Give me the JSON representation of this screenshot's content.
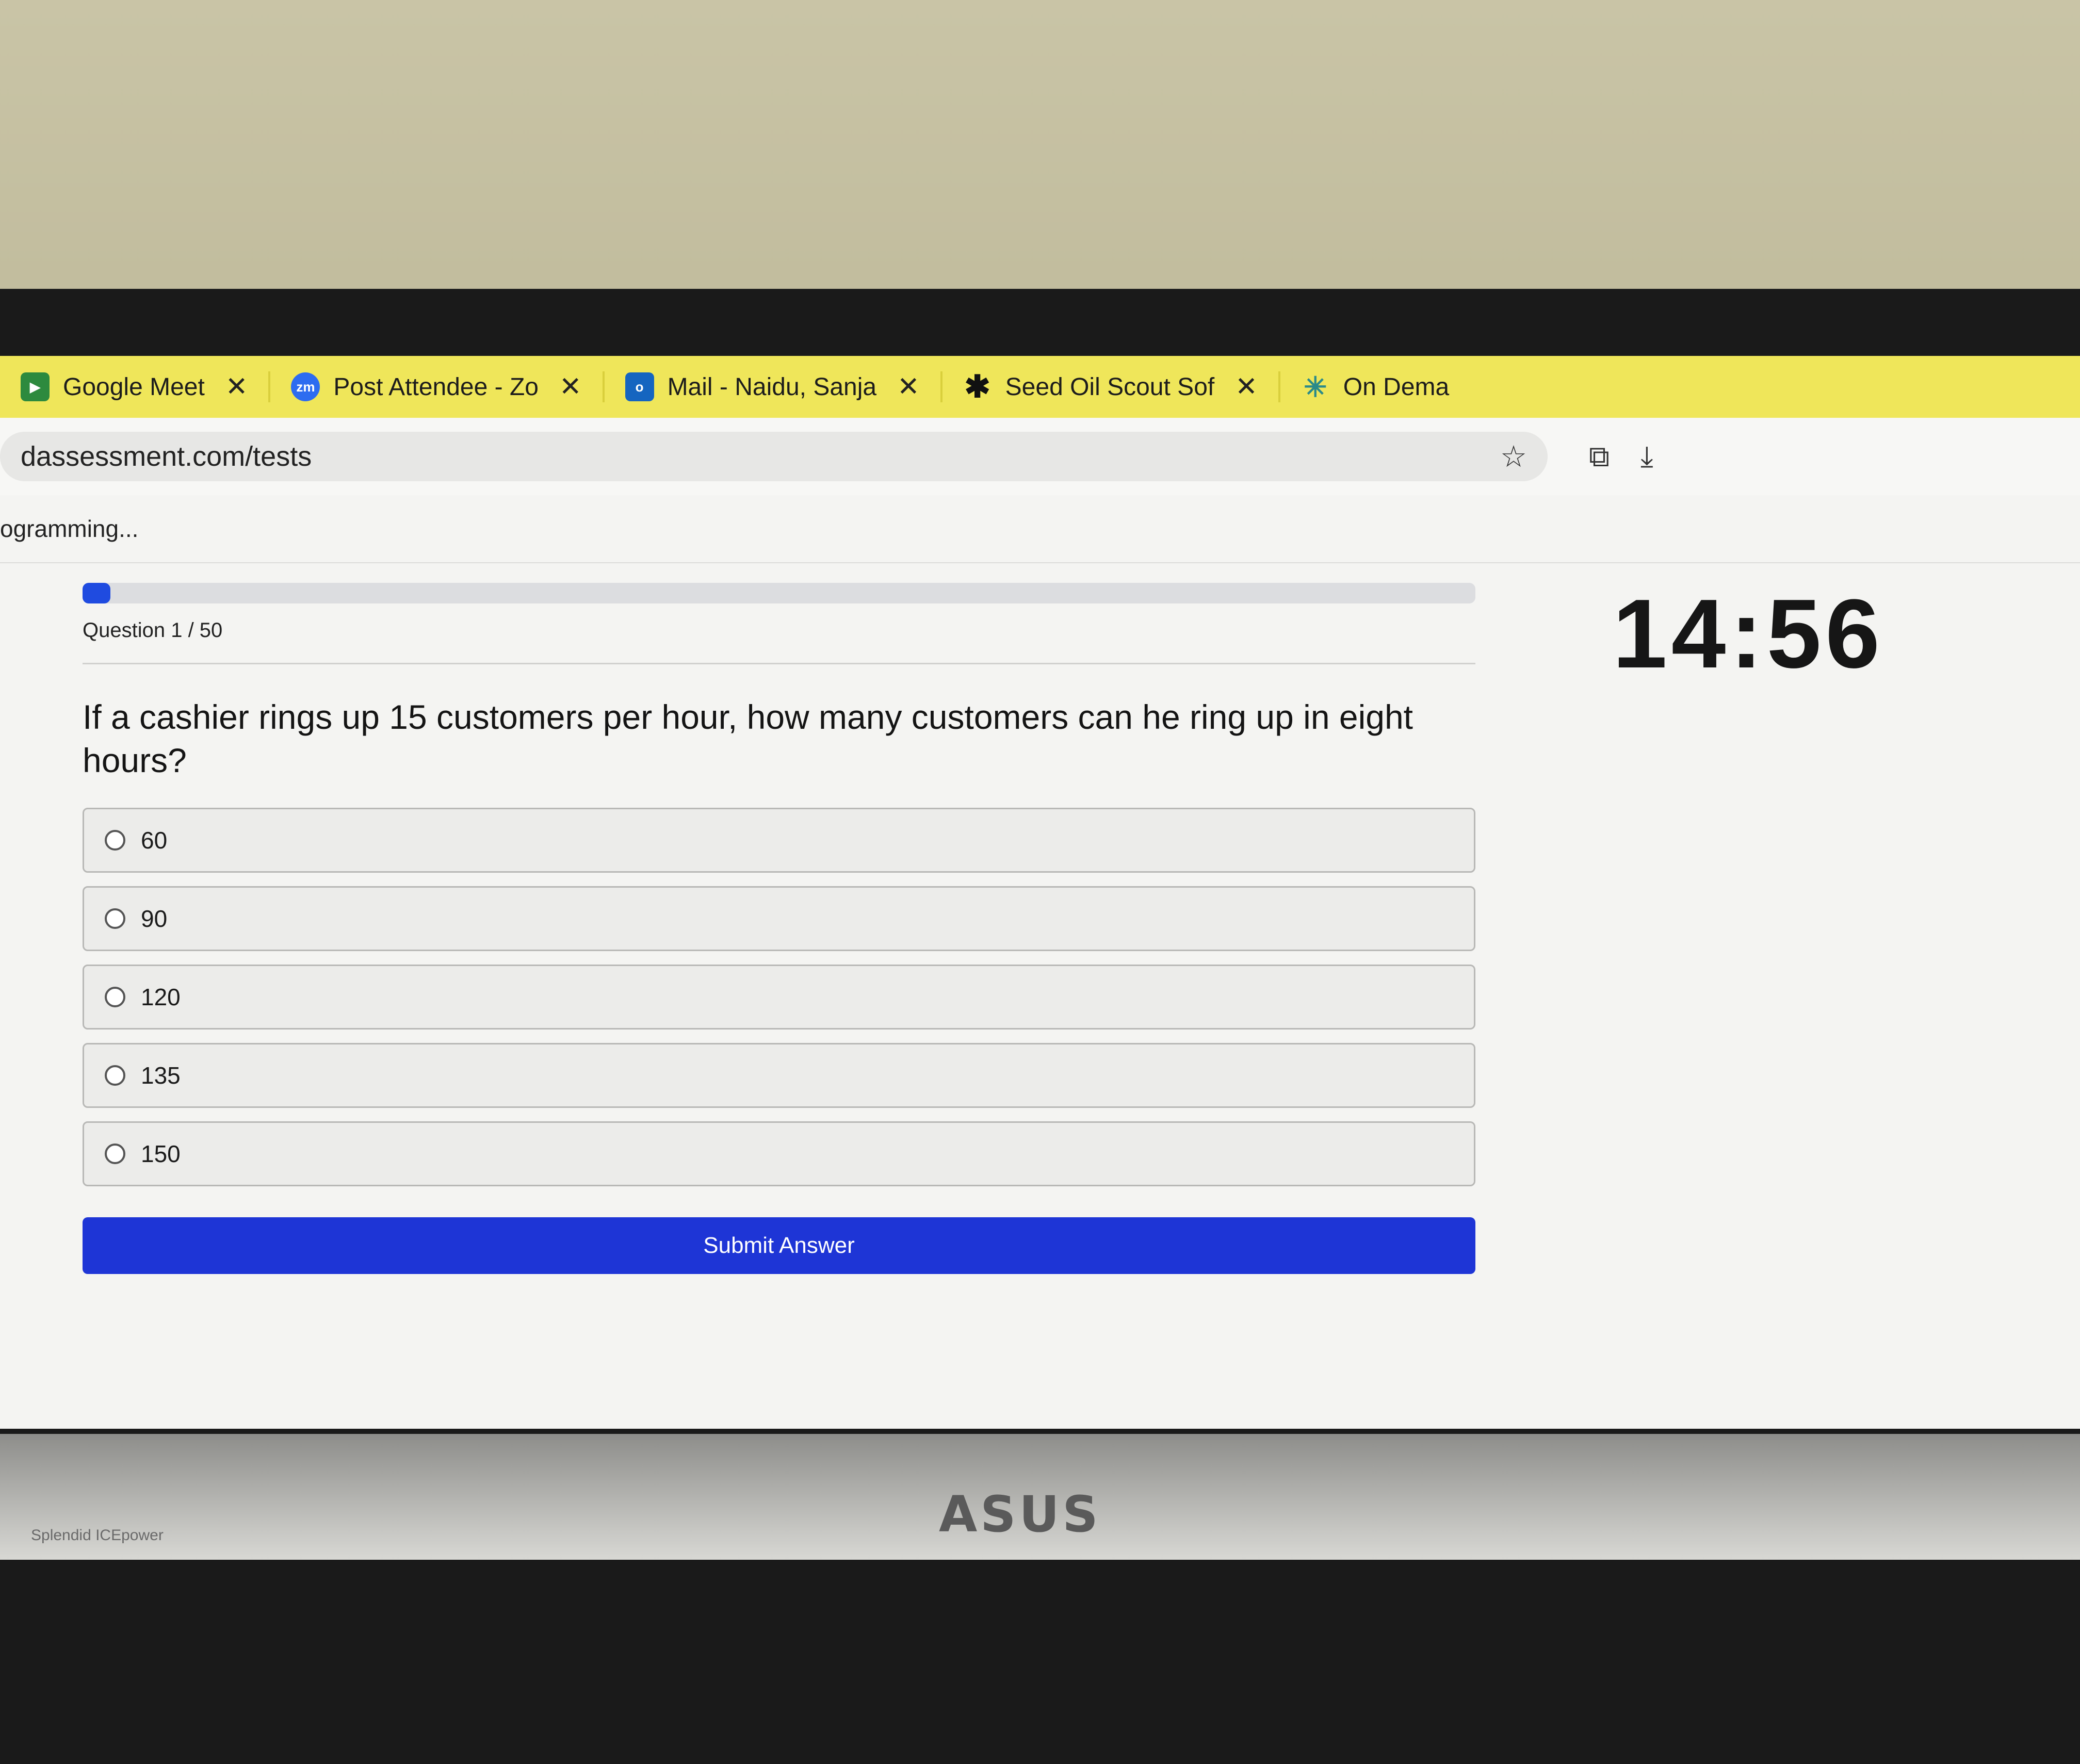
{
  "browser": {
    "tabs": [
      {
        "label": "Google Meet",
        "icon": "google-meet-icon"
      },
      {
        "label": "Post Attendee - Zo",
        "icon": "zoom-icon"
      },
      {
        "label": "Mail - Naidu, Sanja",
        "icon": "outlook-icon"
      },
      {
        "label": "Seed Oil Scout Sof",
        "icon": "asterisk-icon"
      },
      {
        "label": "On Dema",
        "icon": "perplexity-icon"
      }
    ],
    "url": "dassessment.com/tests"
  },
  "page": {
    "course_title": "ogramming..."
  },
  "quiz": {
    "timer": "14:56",
    "question_counter": "Question 1 / 50",
    "progress_fraction": 0.02,
    "question_text": "If a cashier rings up 15 customers per hour, how many customers can he ring up in eight hours?",
    "options": [
      "60",
      "90",
      "120",
      "135",
      "150"
    ],
    "submit_label": "Submit Answer"
  },
  "monitor": {
    "brand": "ASUS",
    "sub_label": "Splendid ICEpower"
  },
  "colors": {
    "accent": "#1e35d6",
    "tabbar": "#efe65a"
  }
}
